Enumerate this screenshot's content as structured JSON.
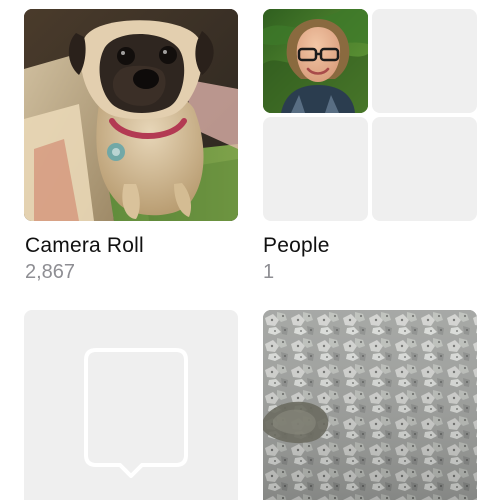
{
  "albums": [
    {
      "title": "Camera Roll",
      "count": "2,867"
    },
    {
      "title": "People",
      "count": "1"
    }
  ],
  "icons": {
    "placeholder": "speech-bubble-placeholder-icon"
  }
}
